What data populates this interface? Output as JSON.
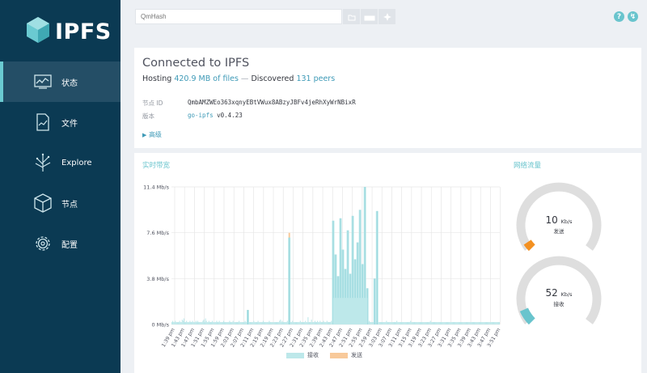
{
  "brand": {
    "name": "IPFS",
    "logo_icon": "ipfs-cube-icon",
    "accent": "#69c4cd",
    "sidebar_bg": "#0b3a53"
  },
  "nav": [
    {
      "label": "状态",
      "icon": "status-chart-icon",
      "active": true
    },
    {
      "label": "文件",
      "icon": "files-icon",
      "active": false
    },
    {
      "label": "Explore",
      "icon": "explore-tree-icon",
      "active": false
    },
    {
      "label": "节点",
      "icon": "peers-cube-icon",
      "active": false
    },
    {
      "label": "配置",
      "icon": "settings-gear-icon",
      "active": false
    }
  ],
  "search": {
    "placeholder": "QmHash"
  },
  "status": {
    "title": "Connected to IPFS",
    "hosting_prefix": "Hosting ",
    "hosting_value": "420.9 MB of files",
    "separator": " — ",
    "discovered_prefix": "Discovered ",
    "discovered_value": "131 peers",
    "peer_id_label": "节点 ID",
    "peer_id": "QmbAMZWEo363xqnyEBtVWux8ABzyJBFv4jeRhXyWrNBixR",
    "version_label": "版本",
    "version_name": "go-ipfs",
    "version_number": " v0.4.23",
    "advanced": "高级"
  },
  "bandwidth": {
    "title": "实时带宽"
  },
  "traffic": {
    "title": "网络流量",
    "out": {
      "value": "10",
      "unit": "Kb/s",
      "label": "发送",
      "fraction": 0.04,
      "color": "#f39021"
    },
    "in": {
      "value": "52",
      "unit": "Kb/s",
      "label": "接收",
      "fraction": 0.08,
      "color": "#69c4cd"
    }
  },
  "chart_data": {
    "type": "bar",
    "title": "实时带宽",
    "y_tick_labels": [
      "11.4 Mb/s",
      "7.6 Mb/s",
      "3.8 Mb/s",
      "0 Mb/s"
    ],
    "ylim": [
      0,
      11.4
    ],
    "y_unit": "Mb/s",
    "x_tick_labels": [
      "1:39 pm",
      "1:43 pm",
      "1:47 pm",
      "1:51 pm",
      "1:55 pm",
      "1:59 pm",
      "2:03 pm",
      "2:07 pm",
      "2:11 pm",
      "2:15 pm",
      "2:19 pm",
      "2:23 pm",
      "2:27 pm",
      "2:31 pm",
      "2:35 pm",
      "2:39 pm",
      "2:43 pm",
      "2:47 pm",
      "2:51 pm",
      "2:55 pm",
      "2:59 pm",
      "3:03 pm",
      "3:07 pm",
      "3:11 pm",
      "3:15 pm",
      "3:19 pm",
      "3:23 pm",
      "3:27 pm",
      "3:31 pm",
      "3:35 pm",
      "3:39 pm",
      "3:43 pm",
      "3:47 pm",
      "3:51 pm"
    ],
    "grid": true,
    "legend": "bottom",
    "series": [
      {
        "name": "接收",
        "color": "#bde8ea",
        "peak_color": "#69c4cd",
        "values": [
          0.2,
          0.3,
          0.2,
          0.2,
          0.3,
          0.2,
          0.2,
          0.2,
          0.2,
          0.3,
          0.2,
          0.2,
          0.4,
          0.3,
          0.5,
          0.2,
          0.2,
          0.3,
          0.2,
          0.2,
          0.2,
          0.3,
          0.2,
          0.2,
          0.3,
          0.2,
          0.2,
          0.2,
          0.3,
          0.2,
          0.3,
          0.2,
          0.2,
          0.2,
          0.2,
          0.2,
          0.3,
          0.4,
          0.2,
          0.5,
          0.3,
          0.2,
          0.2,
          0.3,
          0.2,
          0.2,
          0.2,
          0.3,
          0.2,
          0.2,
          0.2,
          0.2,
          0.3,
          0.2,
          0.2,
          0.3,
          0.2,
          0.2,
          0.2,
          0.2,
          0.3,
          0.2,
          0.2,
          0.2,
          0.2,
          0.2,
          0.2,
          0.3,
          0.2,
          0.2,
          0.2,
          0.3,
          0.2,
          0.2,
          0.2,
          0.2,
          0.2,
          0.2,
          0.3,
          0.2,
          0.2,
          0.2,
          0.2,
          0.2,
          0.2,
          0.3,
          0.2,
          0.2,
          0.2,
          0.5,
          0.2,
          0.2,
          0.2,
          0.2,
          0.2,
          0.3,
          0.2,
          0.2,
          0.2,
          0.2,
          0.3,
          0.2,
          0.2,
          0.2,
          0.2,
          0.2,
          0.3,
          0.2,
          0.2,
          0.2,
          0.2,
          0.2,
          0.2,
          0.3,
          0.2,
          0.2,
          0.2,
          0.2,
          0.2,
          0.2,
          0.2,
          0.2,
          0.2,
          0.2,
          0.2,
          0.3,
          0.4,
          0.2,
          0.3,
          0.2,
          0.2,
          0.2,
          0.2,
          0.2,
          0.3,
          0.2,
          0.2,
          0.3,
          0.2,
          0.2,
          0.3,
          0.2,
          0.2,
          0.2,
          0.2,
          0.2,
          0.2,
          0.2,
          0.2,
          0.3,
          0.2,
          0.2,
          0.2,
          0.2,
          0.2,
          0.3,
          0.2,
          0.2,
          0.6,
          0.2,
          0.2,
          0.2,
          0.4,
          0.2,
          0.2,
          0.2,
          0.3,
          0.2,
          0.2,
          0.3,
          0.2,
          0.2,
          0.3,
          0.2,
          0.2,
          0.2,
          0.3,
          0.2,
          0.2,
          0.2,
          0.3,
          0.2,
          0.2,
          0.2,
          0.2,
          0.3,
          0.2,
          0.2,
          0.2,
          0.2,
          0.2,
          0.2,
          0.5,
          0.2,
          0.2,
          0.2,
          0.2,
          0.3,
          0.2,
          0.2,
          0.2,
          0.2,
          0.2,
          0.2,
          0.3,
          0.2,
          0.2,
          0.2,
          0.2,
          0.3,
          0.2,
          0.2,
          0.2,
          0.2,
          0.2,
          0.2,
          0.4,
          0.2,
          0.2,
          0.2,
          0.2,
          0.2,
          0.2,
          0.3,
          0.2,
          0.2,
          0.2,
          0.2,
          0.2,
          0.3,
          0.2,
          0.2,
          0.2,
          0.2,
          0.2,
          0.2,
          0.2,
          0.2,
          0.3,
          0.2,
          0.2,
          0.2,
          0.2,
          0.2,
          0.2,
          0.2,
          0.2,
          0.2,
          0.2,
          0.3,
          0.2,
          0.2,
          0.2,
          0.2,
          0.2,
          0.2,
          0.2,
          0.2,
          0.2,
          0.2,
          0.2,
          0.3,
          0.2,
          0.2,
          0.2,
          0.2,
          0.2,
          0.2,
          0.2,
          0.2,
          0.2,
          0.2,
          0.2,
          0.2,
          0.2,
          0.2,
          0.2,
          0.3,
          0.2,
          0.2,
          0.2,
          0.2,
          0.2,
          0.2,
          0.2,
          0.2,
          0.2,
          0.2,
          0.2,
          0.2,
          0.2,
          0.2,
          0.2,
          0.2,
          0.2,
          0.2,
          0.2,
          0.2,
          0.2,
          0.2,
          0.3,
          0.2,
          0.2,
          0.2,
          0.2,
          0.2,
          0.2,
          0.2,
          0.2,
          0.2,
          0.2,
          0.2,
          0.2,
          0.2,
          0.2,
          0.2,
          0.2,
          0.2,
          0.2,
          0.2,
          0.2,
          0.2,
          0.2,
          0.2,
          0.2,
          0.2,
          0.2,
          0.2,
          0.2,
          0.2,
          0.2,
          0.2,
          0.2,
          0.2,
          0.2,
          0.2,
          0.2,
          0.2,
          0.2,
          0.2,
          0.2,
          0.2,
          0.2,
          0.2,
          0.2,
          0.2,
          0.2,
          0.2,
          0.2,
          0.2,
          0.2,
          0.2,
          0.2,
          0.2,
          0.2,
          0.2,
          0.2,
          0.2,
          0.2,
          0.2,
          0.2,
          0.2,
          0.2,
          0.2,
          0.2,
          0.2,
          0.2,
          0.2,
          0.2,
          0.2,
          0.2,
          0.2,
          0.2,
          0.2,
          0.2,
          0.2,
          0.2,
          0.2,
          0.2,
          0.2,
          0.2
        ]
      },
      {
        "name": "发送",
        "color": "#f8c99a"
      }
    ],
    "spikes": [
      {
        "x": "2:09 pm",
        "recv": 1.2,
        "send": 1.2
      },
      {
        "x": "2:26 pm",
        "recv": 7.2,
        "send": 7.6
      },
      {
        "x": "2:44 pm",
        "recv": 8.6
      },
      {
        "x": "2:45 pm",
        "recv": 5.8
      },
      {
        "x": "2:46 pm",
        "recv": 4.0
      },
      {
        "x": "2:47 pm",
        "recv": 8.8
      },
      {
        "x": "2:48 pm",
        "recv": 6.2
      },
      {
        "x": "2:49 pm",
        "recv": 4.6
      },
      {
        "x": "2:50 pm",
        "recv": 7.8
      },
      {
        "x": "2:51 pm",
        "recv": 4.2
      },
      {
        "x": "2:52 pm",
        "recv": 9.0
      },
      {
        "x": "2:53 pm",
        "recv": 5.4
      },
      {
        "x": "2:54 pm",
        "recv": 6.8
      },
      {
        "x": "2:55 pm",
        "recv": 9.5
      },
      {
        "x": "2:56 pm",
        "recv": 5.0
      },
      {
        "x": "2:57 pm",
        "recv": 11.4
      },
      {
        "x": "2:58 pm",
        "recv": 3.0
      },
      {
        "x": "3:01 pm",
        "recv": 3.8
      },
      {
        "x": "3:02 pm",
        "recv": 9.4
      }
    ]
  }
}
